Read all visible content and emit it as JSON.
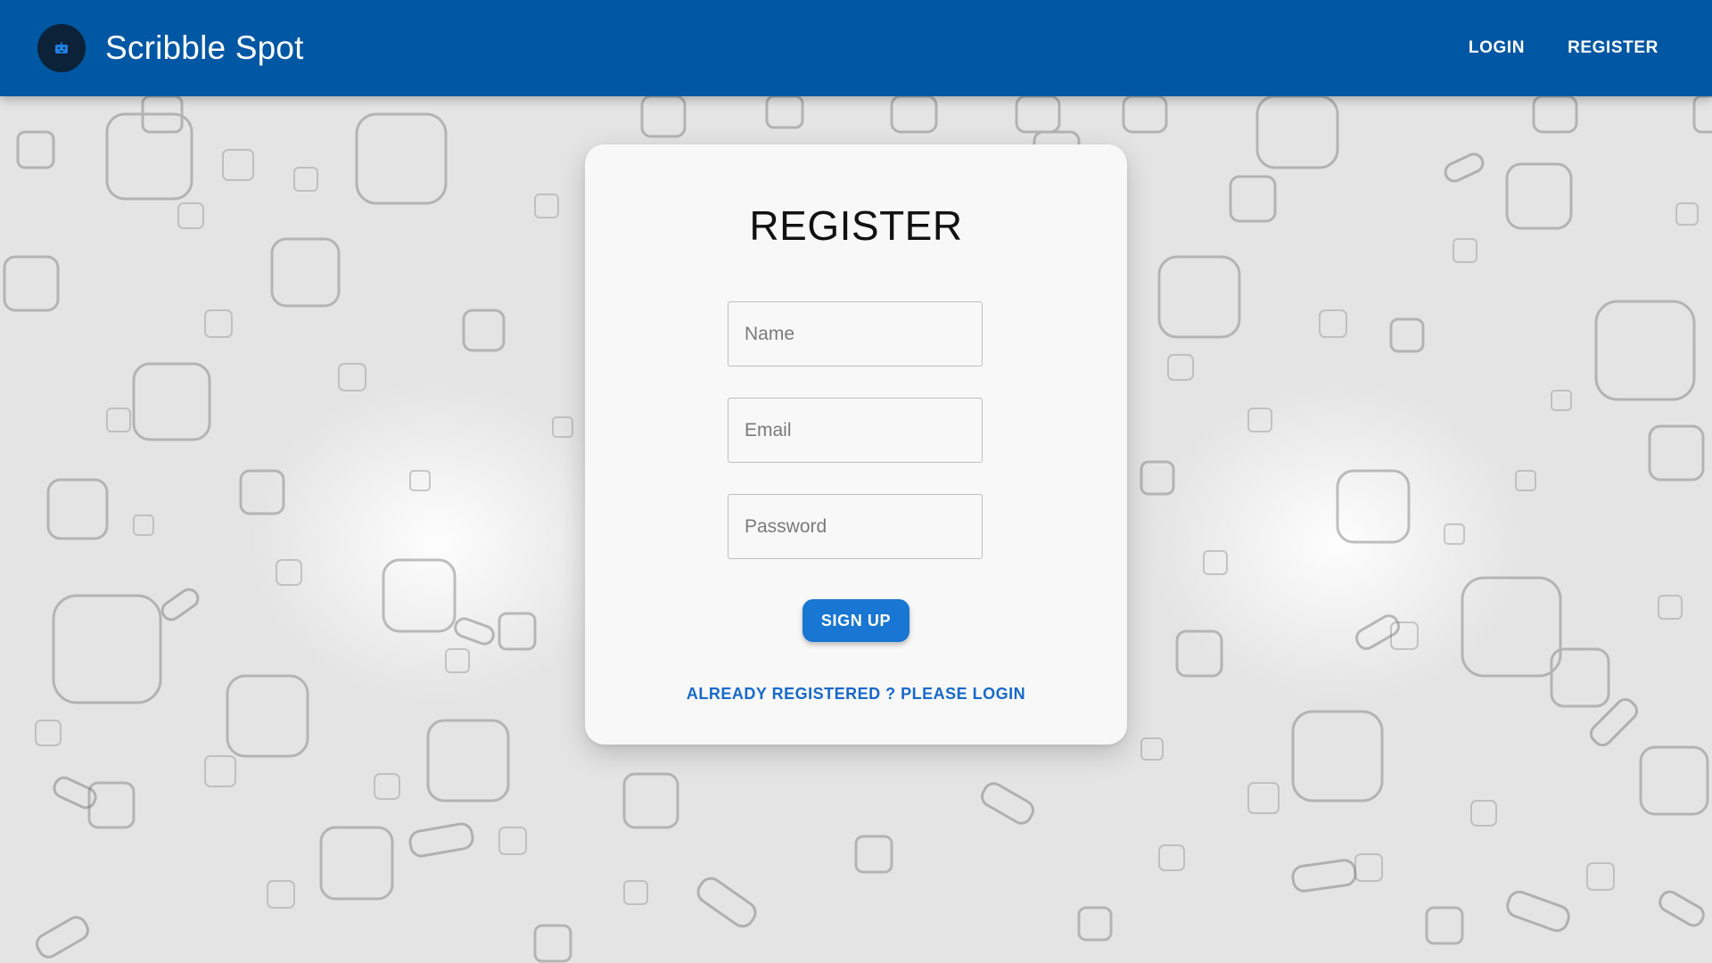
{
  "app": {
    "title": "Scribble Spot",
    "brand_icon": "robot-face-icon",
    "brand_color": "#0057a3"
  },
  "nav": {
    "login_label": "LOGIN",
    "register_label": "REGISTER"
  },
  "form": {
    "title": "REGISTER",
    "name_placeholder": "Name",
    "email_placeholder": "Email",
    "password_placeholder": "Password",
    "signup_label": "SIGN UP",
    "login_prompt": "ALREADY REGISTERED ? PLEASE LOGIN",
    "button_color": "#1976d2",
    "link_color": "#1769c9"
  },
  "background": {
    "pattern": "scattered rounded-square outlines"
  }
}
